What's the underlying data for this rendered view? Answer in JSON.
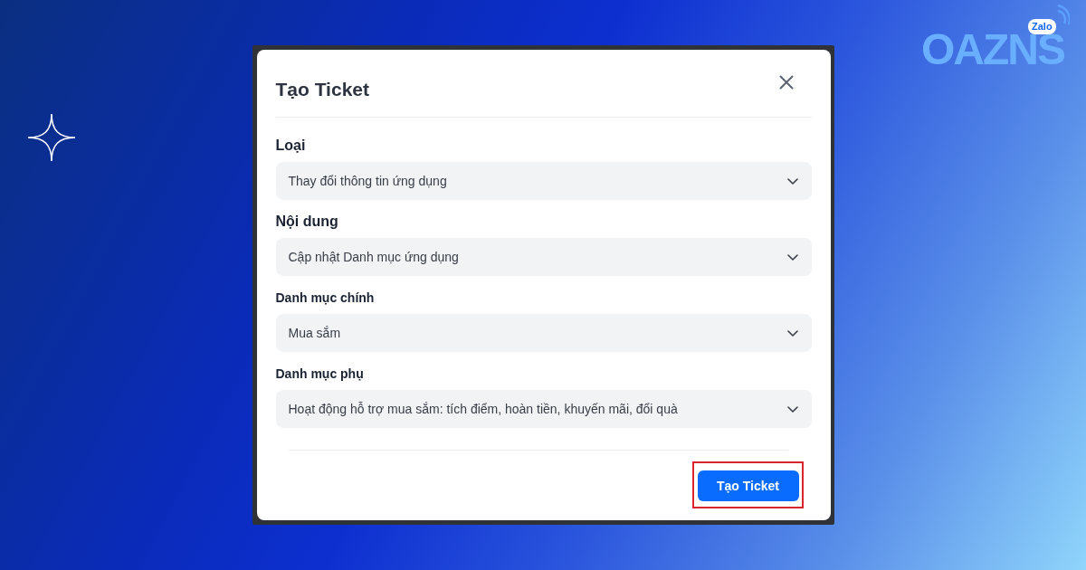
{
  "brand": {
    "wordmark": "OAZNS",
    "badge": "Zalo"
  },
  "dialog": {
    "title": "Tạo Ticket",
    "fields": [
      {
        "kind": "main",
        "label": "Loại",
        "value": "Thay đổi thông tin ứng dụng"
      },
      {
        "kind": "main",
        "label": "Nội dung",
        "value": "Cập nhật Danh mục ứng dụng"
      },
      {
        "kind": "sub",
        "label": "Danh mục chính",
        "value": "Mua sắm"
      },
      {
        "kind": "sub",
        "label": "Danh mục phụ",
        "value": "Hoạt động hỗ trợ mua sắm: tích điểm, hoàn tiền, khuyến mãi, đổi quà"
      }
    ],
    "submit": {
      "label": "Tạo Ticket",
      "highlighted": true
    }
  }
}
